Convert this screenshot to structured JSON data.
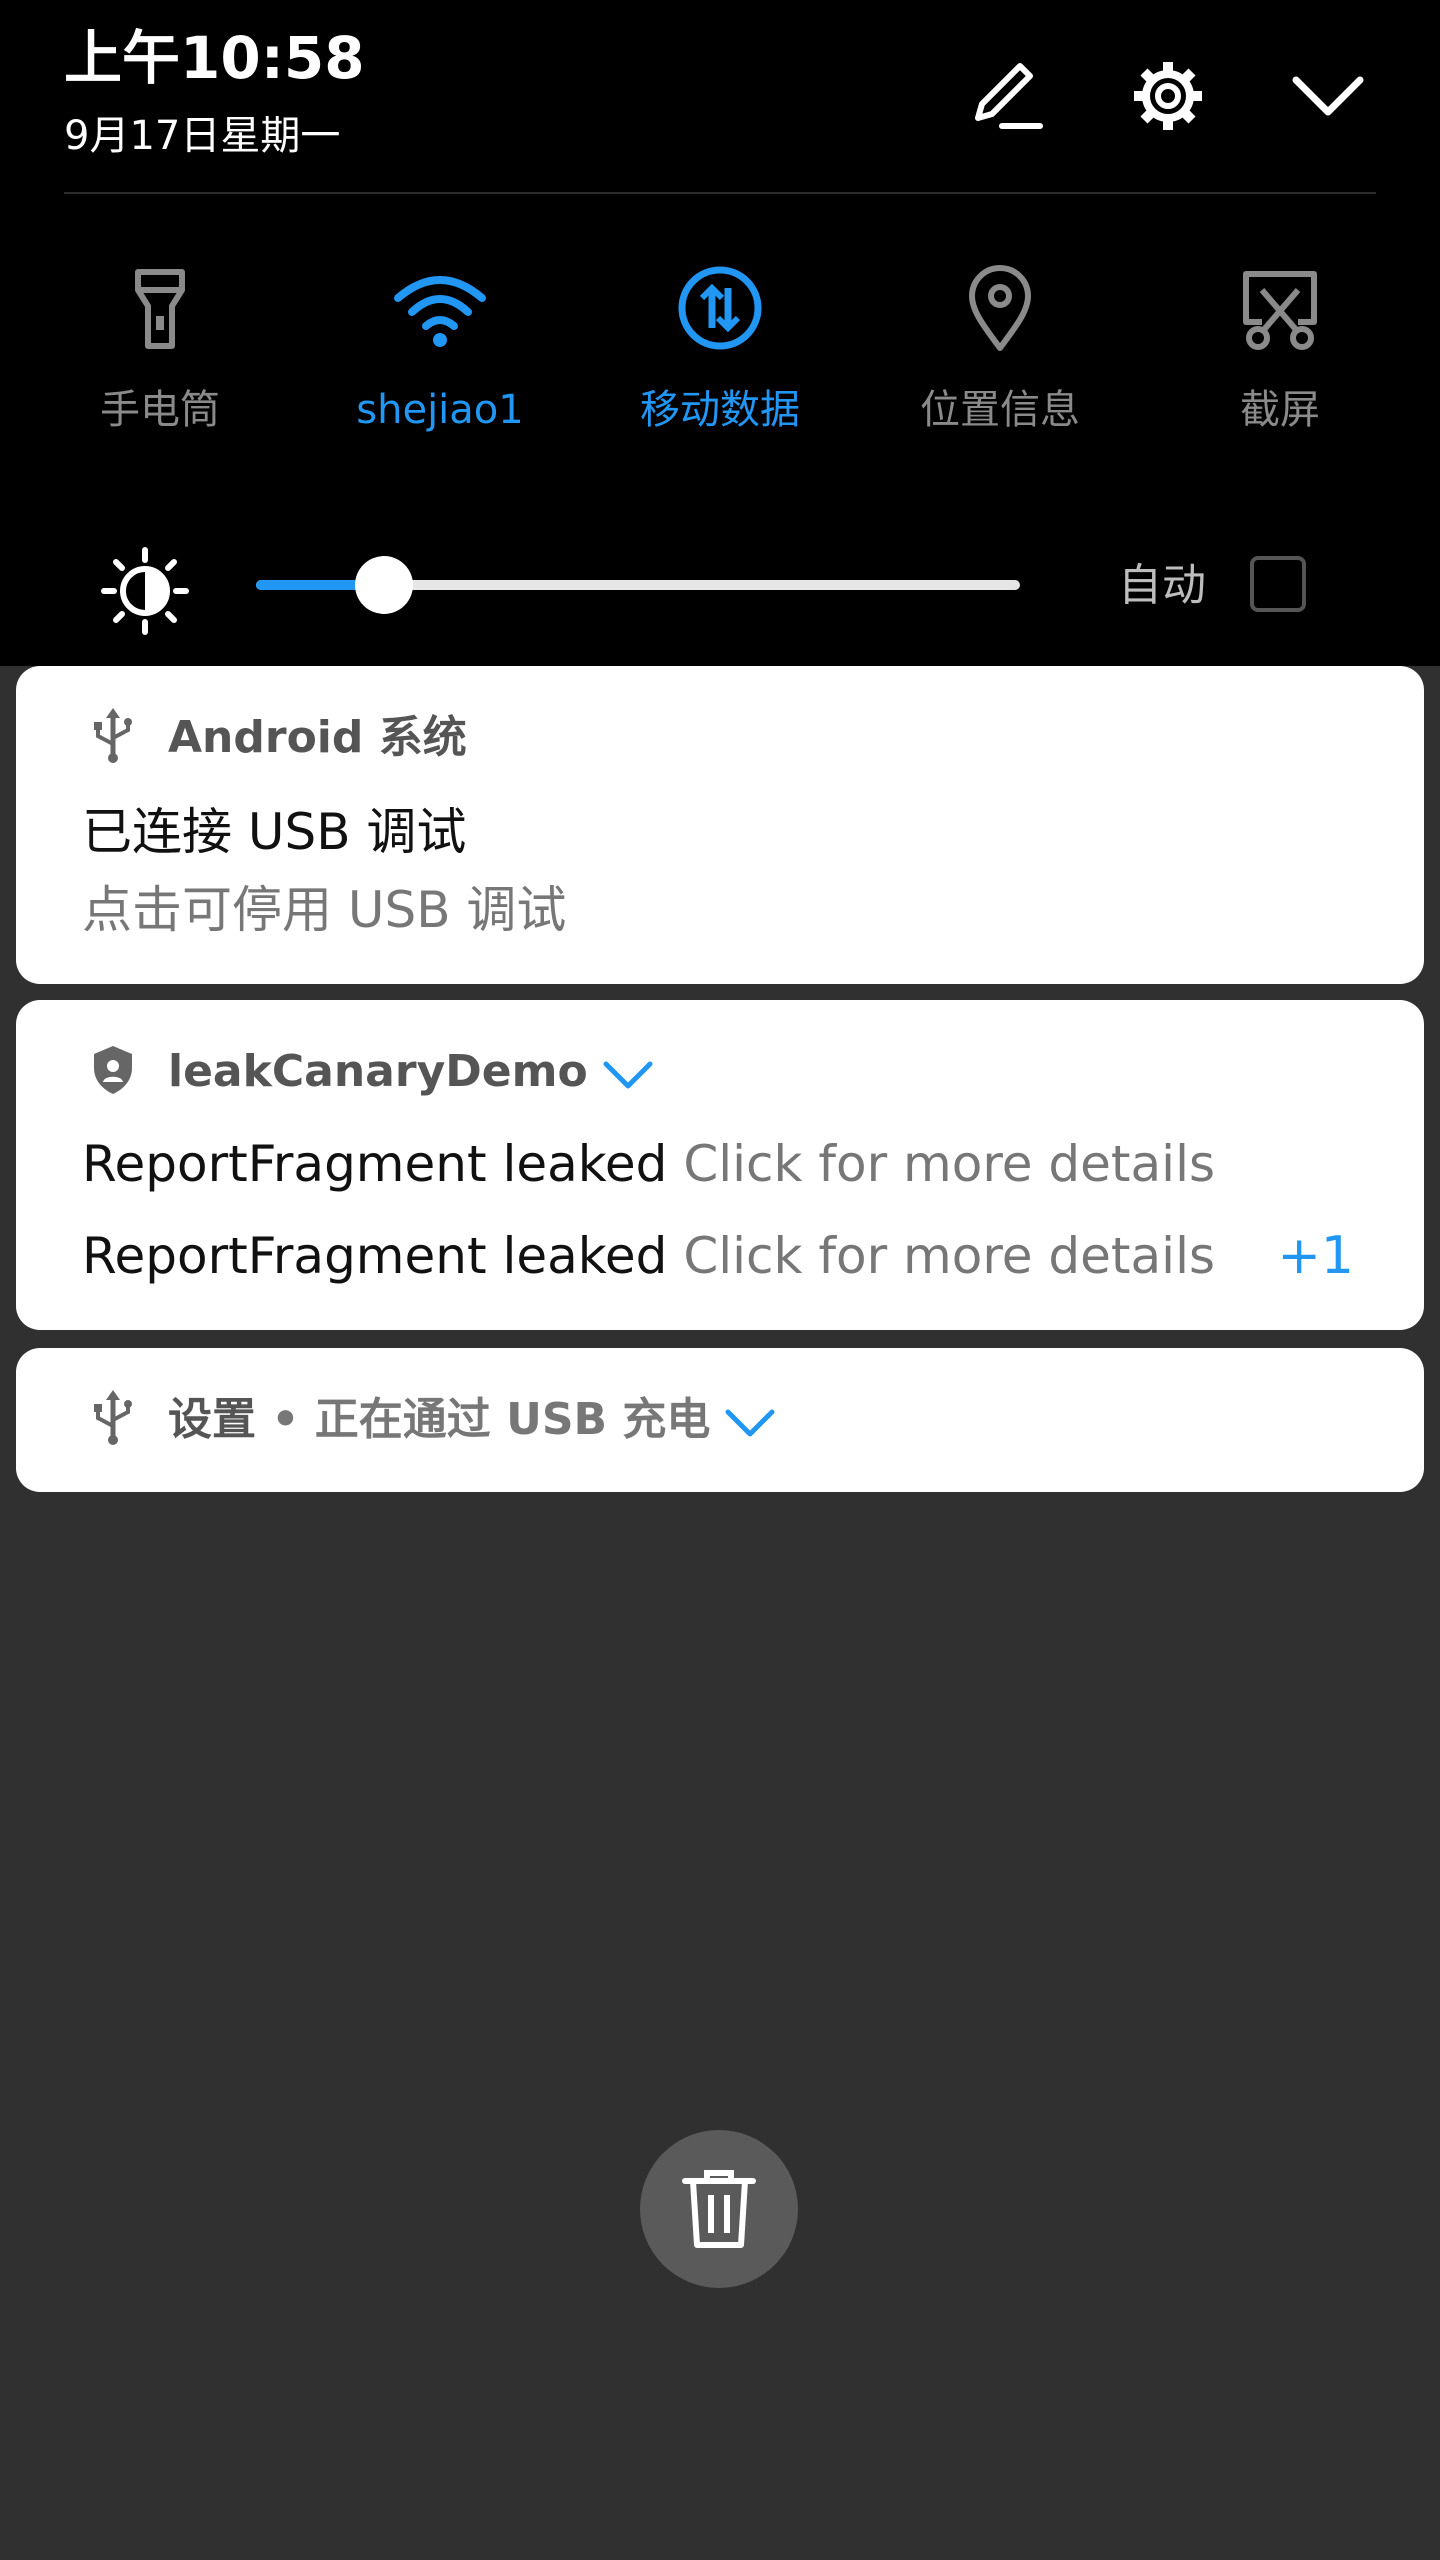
{
  "status": {
    "time": "上午10:58",
    "date": "9月17日星期一"
  },
  "top_actions": {
    "edit_icon": "pencil-icon",
    "settings_icon": "gear-icon",
    "collapse_icon": "chevron-down-icon"
  },
  "tiles": [
    {
      "label": "手电筒",
      "icon": "flashlight-icon",
      "active": false
    },
    {
      "label": "shejiao1",
      "icon": "wifi-icon",
      "active": true
    },
    {
      "label": "移动数据",
      "icon": "mobile-data-icon",
      "active": true
    },
    {
      "label": "位置信息",
      "icon": "location-icon",
      "active": false
    },
    {
      "label": "截屏",
      "icon": "screenshot-icon",
      "active": false
    }
  ],
  "brightness": {
    "level_fraction": 0.168,
    "auto_label": "自动",
    "auto_checked": false
  },
  "notifications": [
    {
      "app": "Android 系统",
      "icon": "usb-icon",
      "title": "已连接 USB 调试",
      "text": "点击可停用 USB 调试"
    },
    {
      "app": "leakCanaryDemo",
      "icon": "shield-icon",
      "lines": [
        {
          "title": "ReportFragment leaked",
          "text": "Click for more details"
        },
        {
          "title": "ReportFragment leaked",
          "text": "Click for more details"
        }
      ],
      "more_count": "+1"
    },
    {
      "app": "设置",
      "separator": "•",
      "subtitle": "正在通过 USB 充电",
      "icon": "usb-icon"
    }
  ],
  "colors": {
    "accent": "#2196f3",
    "shade": "#000000",
    "background": "#303030"
  }
}
